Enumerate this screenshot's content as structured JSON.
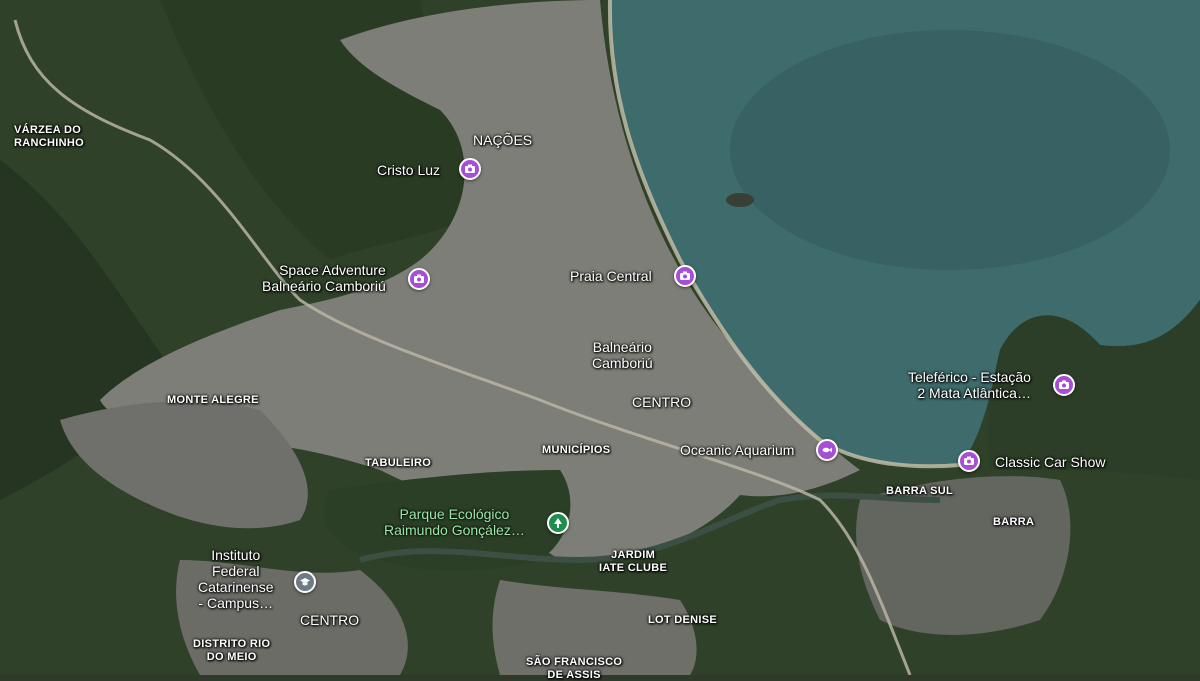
{
  "map": {
    "colors": {
      "ocean": "#3f6f6f",
      "forest": "#2e4027",
      "urban": "#8a8a86",
      "poi_purple": "#a64fd6",
      "poi_green": "#1e8e4e",
      "poi_gray": "#6e7a86"
    },
    "neighborhoods": {
      "varzea": "VÁRZEA DO\nRANCHINHO",
      "nacoes": "NAÇÕES",
      "monte_alegre": "MONTE ALEGRE",
      "tabuleiro": "TABULEIRO",
      "municipios": "MUNICÍPIOS",
      "centro_main": "CENTRO",
      "barra_sul": "BARRA SUL",
      "barra": "BARRA",
      "jardim_iate": "JARDIM\nIATE CLUBE",
      "lot_denise": "LOT DENISE",
      "sao_francisco": "SÃO FRANCISCO\nDE ASSIS",
      "distrito": "DISTRITO RIO\nDO MEIO",
      "centro_sw": "CENTRO"
    },
    "city_label": "Balneário\nCamboriú",
    "pois": {
      "cristo_luz": {
        "name": "Cristo Luz",
        "icon": "camera-icon"
      },
      "space_adventure": {
        "name": "Space Adventure\nBalneário Camboriú",
        "icon": "camera-icon"
      },
      "praia_central": {
        "name": "Praia Central",
        "icon": "camera-icon"
      },
      "oceanic": {
        "name": "Oceanic Aquarium",
        "icon": "fish-icon"
      },
      "teleferico": {
        "name": "Teleférico - Estação\n2 Mata Atlântica…",
        "icon": "camera-icon"
      },
      "classic_car": {
        "name": "Classic Car Show",
        "icon": "camera-icon"
      },
      "parque": {
        "name": "Parque Ecológico\nRaimundo Gonçález…",
        "icon": "tree-icon"
      },
      "instituto": {
        "name": "Instituto\nFederal\nCatarinense\n- Campus…",
        "icon": "school-icon"
      }
    }
  }
}
